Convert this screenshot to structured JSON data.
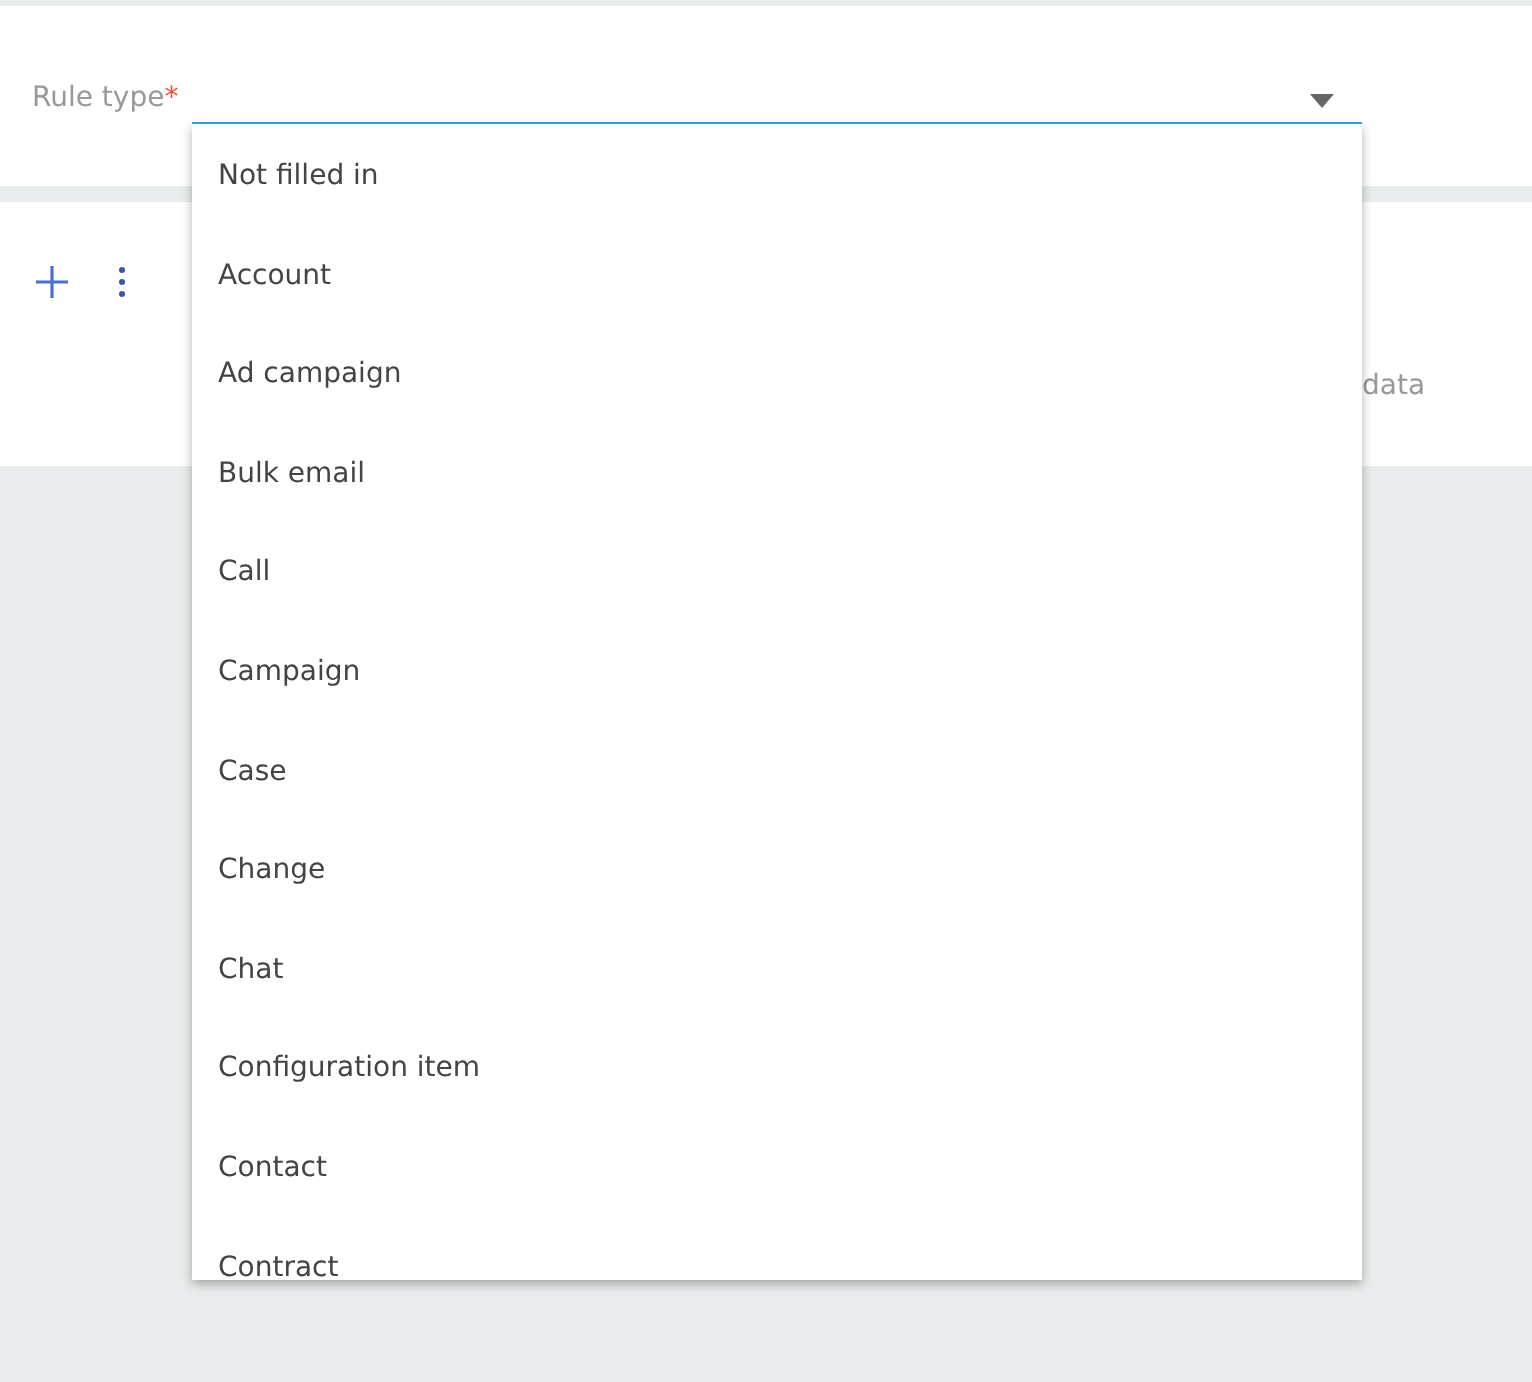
{
  "field": {
    "label": "Rule type",
    "required": true,
    "required_mark": "*",
    "expanded": true
  },
  "toolbar": {
    "trailing_text": "data"
  },
  "dropdown": {
    "options": [
      {
        "label": "Not filled in"
      },
      {
        "label": "Account"
      },
      {
        "label": "Ad campaign"
      },
      {
        "label": "Bulk email"
      },
      {
        "label": "Call"
      },
      {
        "label": "Campaign"
      },
      {
        "label": "Case"
      },
      {
        "label": "Change"
      },
      {
        "label": "Chat"
      },
      {
        "label": "Configuration item"
      },
      {
        "label": "Contact"
      },
      {
        "label": "Contract"
      }
    ]
  }
}
